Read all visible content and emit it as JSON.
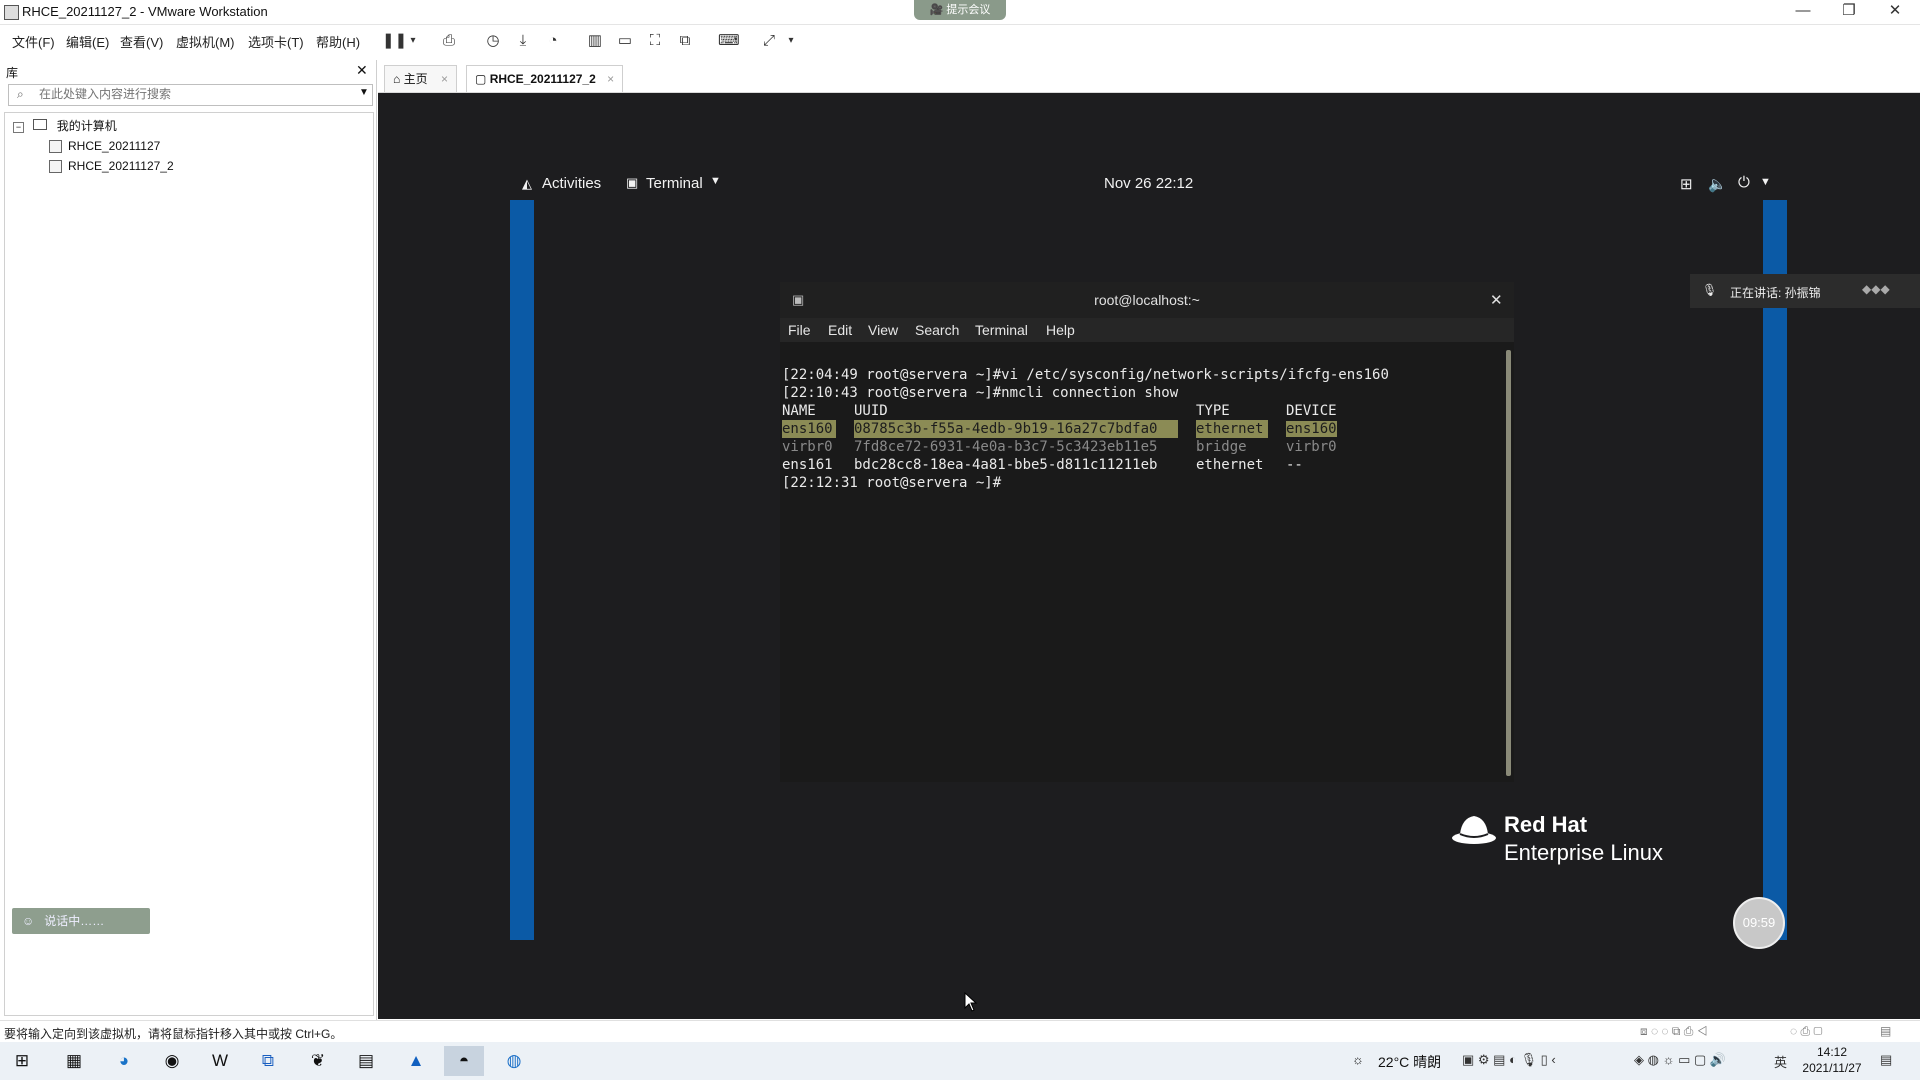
{
  "window": {
    "title": "RHCE_20211127_2 - VMware Workstation",
    "meeting_pill": "🎥 提示会议",
    "controls": [
      "—",
      "❐",
      "✕"
    ]
  },
  "menu": [
    "文件(F)",
    "编辑(E)",
    "查看(V)",
    "虚拟机(M)",
    "选项卡(T)",
    "帮助(H)"
  ],
  "sidebar": {
    "header": "库",
    "search_placeholder": "在此处键入内容进行搜索",
    "tree": {
      "root": "我的计算机",
      "items": [
        "RHCE_20211127",
        "RHCE_20211127_2"
      ]
    },
    "toast": "说话中……"
  },
  "tabs": [
    {
      "label": "主页",
      "icon": "home-icon"
    },
    {
      "label": "RHCE_20211127_2",
      "icon": "vm-icon"
    }
  ],
  "gnome": {
    "activities": "Activities",
    "app_menu": "Terminal",
    "datetime": "Nov 26  22:12"
  },
  "terminal": {
    "title": "root@localhost:~",
    "menu": [
      "File",
      "Edit",
      "View",
      "Search",
      "Terminal",
      "Help"
    ],
    "lines": [
      "[22:04:49 root@servera ~]#vi /etc/sysconfig/network-scripts/ifcfg-ens160",
      "[22:10:43 root@servera ~]#nmcli connection show"
    ],
    "table": {
      "headers": [
        "NAME",
        "UUID",
        "TYPE",
        "DEVICE"
      ],
      "rows": [
        [
          "ens160",
          "08785c3b-f55a-4edb-9b19-16a27c7bdfa0",
          "ethernet",
          "ens160"
        ],
        [
          "virbr0",
          "7fd8ce72-6931-4e0a-b3c7-5c3423eb11e5",
          "bridge",
          "virbr0"
        ],
        [
          "ens161",
          "bdc28cc8-18ea-4a81-bbe5-d811c11211eb",
          "ethernet",
          "--"
        ]
      ]
    },
    "prompt": "[22:12:31 root@servera ~]#"
  },
  "rhel": {
    "line1": "Red Hat",
    "line2": "Enterprise Linux"
  },
  "speaking": "正在讲话: 孙振锦",
  "timer": "09:59",
  "statusbar": "要将输入定向到该虚拟机，请将鼠标指针移入其中或按 Ctrl+G。",
  "taskbar": {
    "weather": "22°C  晴朗",
    "time": "14:12",
    "date": "2021/11/27",
    "ime": "英"
  }
}
